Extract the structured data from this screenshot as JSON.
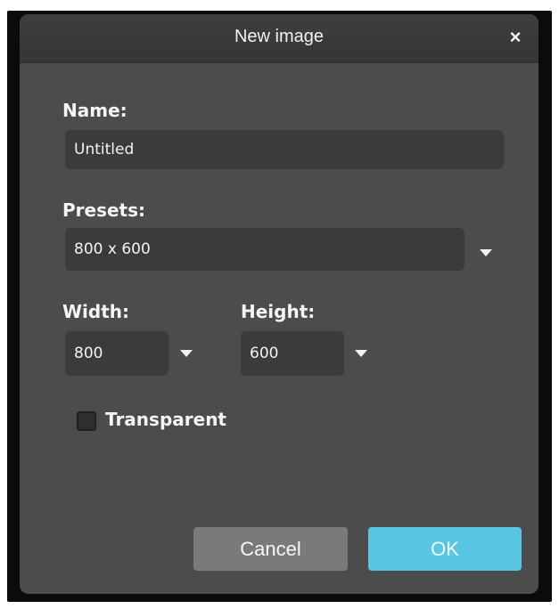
{
  "dialog": {
    "title": "New image",
    "close_glyph": "×",
    "close_icon": "close-icon"
  },
  "name": {
    "label": "Name:",
    "value": "Untitled"
  },
  "presets": {
    "label": "Presets:",
    "value": "800 x 600",
    "dropdown_icon": "chevron-down-icon"
  },
  "width": {
    "label": "Width:",
    "value": "800",
    "dropdown_icon": "chevron-down-icon"
  },
  "height": {
    "label": "Height:",
    "value": "600",
    "dropdown_icon": "chevron-down-icon"
  },
  "transparent": {
    "label": "Transparent",
    "checked": false
  },
  "buttons": {
    "cancel": "Cancel",
    "ok": "OK"
  },
  "colors": {
    "dialog_background": "#4c4c4c",
    "field_background": "#3b3b3b",
    "ok_button": "#58c7e3",
    "cancel_button": "#7a7a7a"
  }
}
